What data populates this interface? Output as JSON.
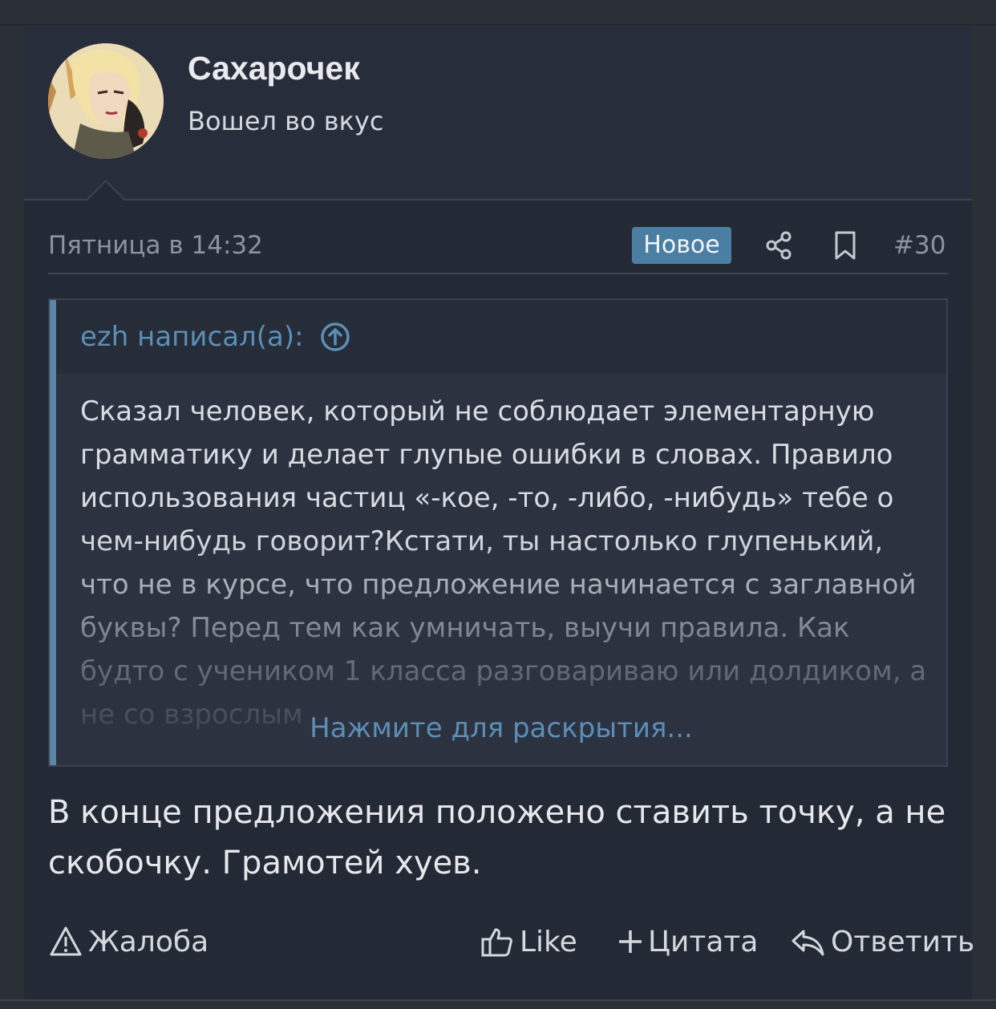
{
  "user": {
    "name": "Сахарочек",
    "title": "Вошел во вкус"
  },
  "meta": {
    "date": "Пятница в 14:32",
    "new_badge": "Новое",
    "post_number": "#30"
  },
  "quote": {
    "author": "ezh написал(а):",
    "text": "Сказал человек, который не соблюдает элементарную грамматику и делает глупые ошибки в словах. Правило использования частиц «-кое, -то, -либо, -нибудь» тебе о чем-нибудь говорит?Кстати, ты настолько глупенький, что не в курсе, что предложение начинается с заглавной буквы? Перед тем как умничать, выучи правила. Как будто с учеником 1 класса разговариваю или долдиком, а не со взрослым",
    "expand_label": "Нажмите для раскрытия..."
  },
  "message": {
    "text": "В конце предложения положено ставить точку, а не скобочку. Грамотей хуев."
  },
  "actions": {
    "report": "Жалоба",
    "like": "Like",
    "quote": "Цитата",
    "reply": "Ответить"
  },
  "icons": {
    "share": "share-icon",
    "bookmark": "bookmark-icon",
    "quote_jump": "arrow-up-circle-icon",
    "report": "warning-triangle-icon",
    "like": "thumbs-up-icon",
    "quote": "plus-icon",
    "reply": "reply-icon"
  },
  "colors": {
    "background": "#2b3037",
    "post_background": "#242a35",
    "accent": "#5b8fb6",
    "badge": "#4a7fa3"
  }
}
